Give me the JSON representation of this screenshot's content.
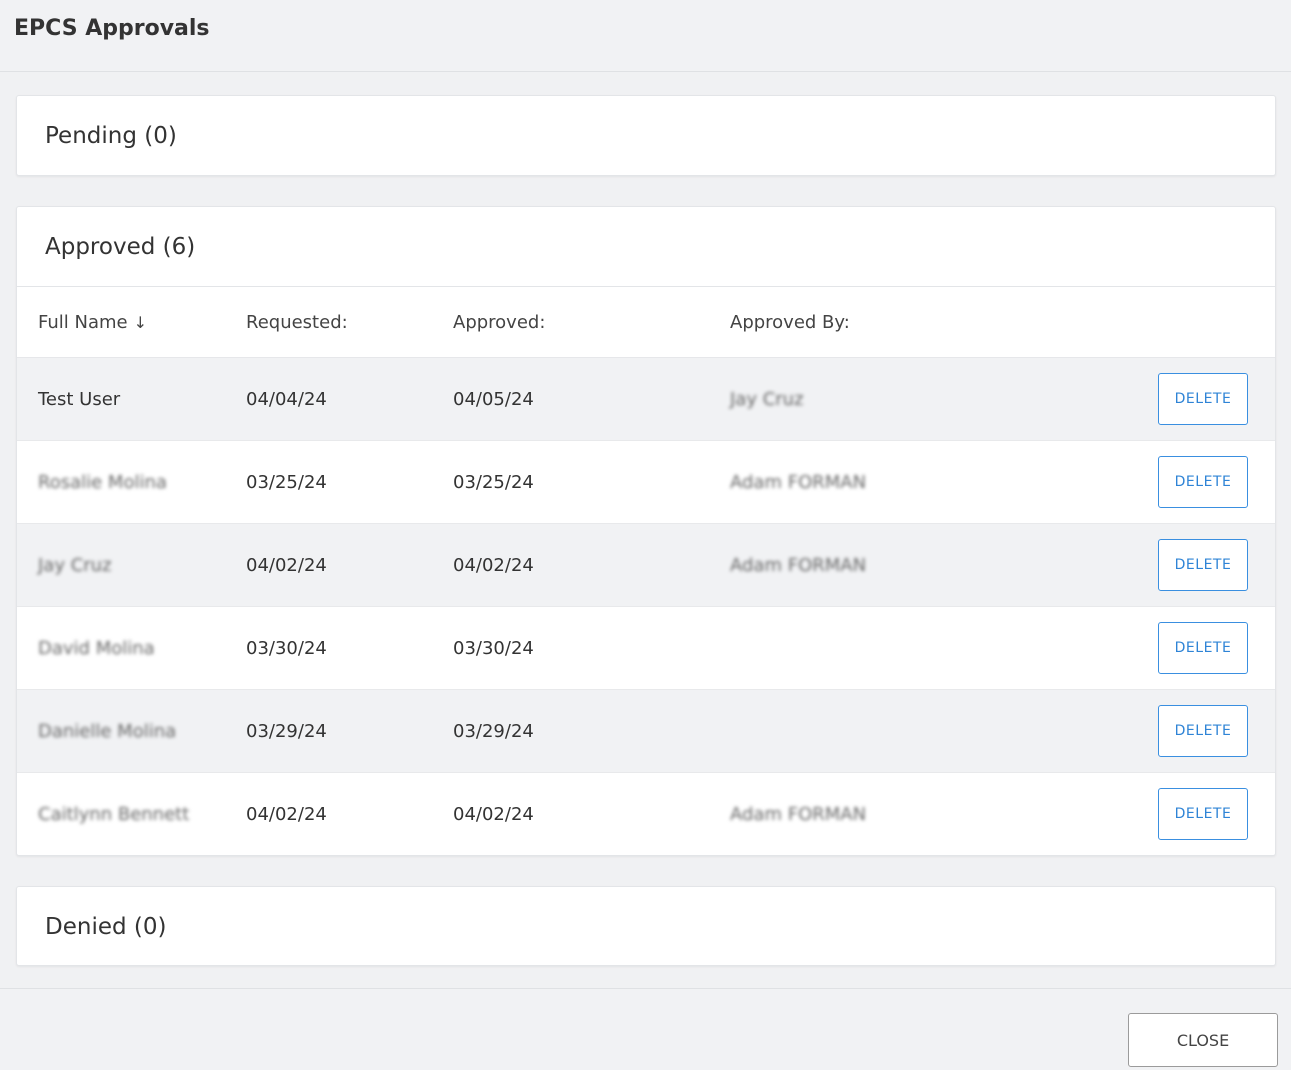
{
  "dialog": {
    "title": "EPCS Approvals"
  },
  "pending": {
    "title": "Pending (0)"
  },
  "approved": {
    "title": "Approved (6)",
    "columns": {
      "full_name": "Full Name",
      "requested": "Requested:",
      "approved": "Approved:",
      "approved_by": "Approved By:"
    },
    "sort_icon": "arrow-down-icon",
    "rows": [
      {
        "name": "Test User",
        "requested": "04/04/24",
        "approved": "04/05/24",
        "approved_by": "Jay Cruz",
        "delete_label": "DELETE"
      },
      {
        "name": "Rosalie Molina",
        "requested": "03/25/24",
        "approved": "03/25/24",
        "approved_by": "Adam FORMAN",
        "delete_label": "DELETE"
      },
      {
        "name": "Jay Cruz",
        "requested": "04/02/24",
        "approved": "04/02/24",
        "approved_by": "Adam FORMAN",
        "delete_label": "DELETE"
      },
      {
        "name": "David Molina",
        "requested": "03/30/24",
        "approved": "03/30/24",
        "approved_by": "",
        "delete_label": "DELETE"
      },
      {
        "name": "Danielle Molina",
        "requested": "03/29/24",
        "approved": "03/29/24",
        "approved_by": "",
        "delete_label": "DELETE"
      },
      {
        "name": "Caitlynn Bennett",
        "requested": "04/02/24",
        "approved": "04/02/24",
        "approved_by": "Adam FORMAN",
        "delete_label": "DELETE"
      }
    ]
  },
  "denied": {
    "title": "Denied (0)"
  },
  "footer": {
    "close_label": "CLOSE"
  },
  "colors": {
    "accent": "#2f84d6",
    "row_alt": "#f1f2f4",
    "background": "#f0f1f3"
  }
}
